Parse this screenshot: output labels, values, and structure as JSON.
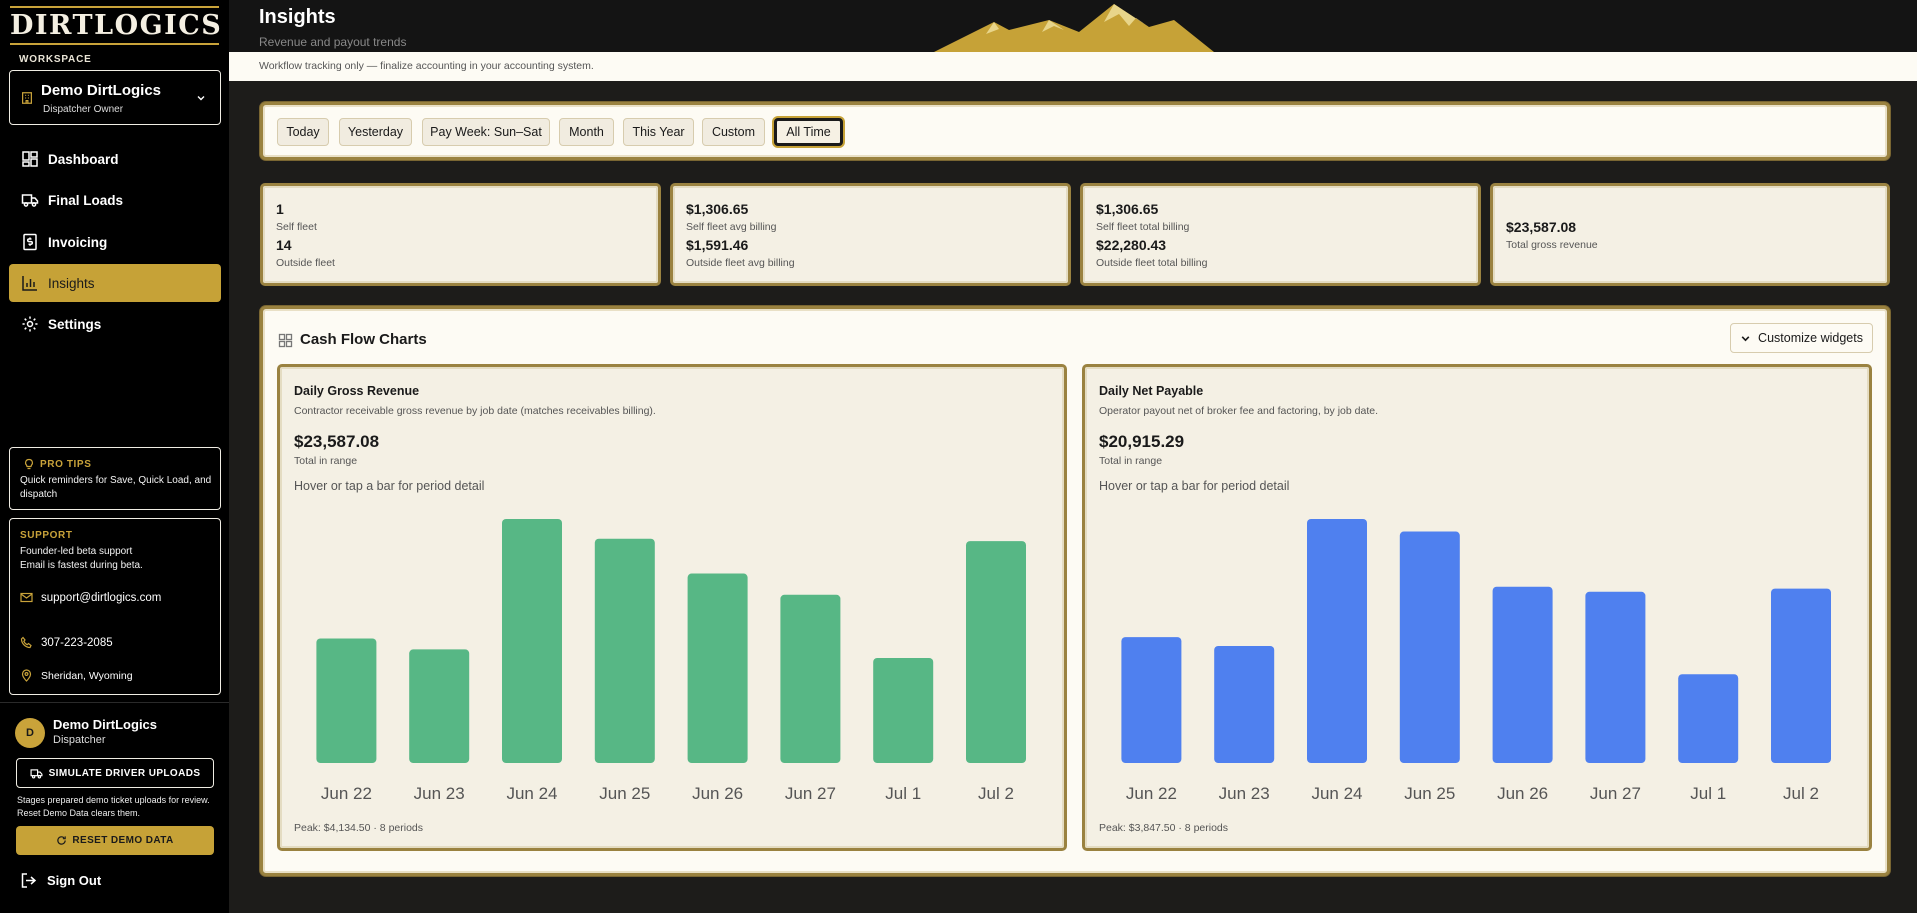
{
  "brand": {
    "logo_text": "DIRTLOGICS"
  },
  "sidebar": {
    "workspace_label": "WORKSPACE",
    "workspace_name": "Demo DirtLogics",
    "workspace_role": "Dispatcher Owner",
    "nav": [
      {
        "label": "Dashboard",
        "icon": "dashboard-icon"
      },
      {
        "label": "Final Loads",
        "icon": "truck-icon"
      },
      {
        "label": "Invoicing",
        "icon": "invoice-icon"
      },
      {
        "label": "Insights",
        "icon": "bar-chart-icon",
        "active": true
      },
      {
        "label": "Settings",
        "icon": "gear-icon"
      }
    ],
    "pro_tips": {
      "title": "PRO TIPS",
      "text": "Quick reminders for Save, Quick Load, and dispatch"
    },
    "support": {
      "title": "SUPPORT",
      "line1": "Founder-led beta support",
      "line2": "Email is fastest during beta.",
      "email": "support@dirtlogics.com",
      "phone": "307-223-2085",
      "location": "Sheridan, Wyoming"
    },
    "user": {
      "initial": "D",
      "name": "Demo DirtLogics",
      "role": "Dispatcher"
    },
    "simulate_label": "SIMULATE DRIVER UPLOADS",
    "simulate_note": "Stages prepared demo ticket uploads for review. Reset Demo Data clears them.",
    "reset_label": "RESET DEMO DATA",
    "sign_out": "Sign Out"
  },
  "header": {
    "title": "Insights",
    "subtitle": "Revenue and payout trends",
    "notice": "Workflow tracking only — finalize accounting in your accounting system."
  },
  "filters": {
    "items": [
      "Today",
      "Yesterday",
      "Pay Week: Sun–Sat",
      "Month",
      "This Year",
      "Custom",
      "All Time"
    ],
    "active": "All Time"
  },
  "stats": {
    "self_fleet": "1",
    "self_fleet_label": "Self fleet",
    "outside_fleet": "14",
    "outside_fleet_label": "Outside fleet",
    "self_avg": "$1,306.65",
    "self_avg_label": "Self fleet avg billing",
    "outside_avg": "$1,591.46",
    "outside_avg_label": "Outside fleet avg billing",
    "self_total": "$1,306.65",
    "self_total_label": "Self fleet total billing",
    "outside_total": "$22,280.43",
    "outside_total_label": "Outside fleet total billing",
    "gross": "$23,587.08",
    "gross_label": "Total gross revenue"
  },
  "cash_flow": {
    "title": "Cash Flow Charts",
    "customize_label": "Customize widgets"
  },
  "colors": {
    "gold": "#c6a237",
    "green": "#57b785",
    "blue": "#4f80ef"
  },
  "chart_data": [
    {
      "type": "bar",
      "title": "Daily Gross Revenue",
      "description": "Contractor receivable gross revenue by job date (matches receivables billing).",
      "total": "$23,587.08",
      "total_label": "Total in range",
      "hint": "Hover or tap a bar for period detail",
      "categories": [
        "Jun 22",
        "Jun 23",
        "Jun 24",
        "Jun 25",
        "Jun 26",
        "Jun 27",
        "Jul 1",
        "Jul 2"
      ],
      "values": [
        2110,
        1925,
        4134.5,
        3800,
        3210,
        2850,
        1780,
        3760
      ],
      "peak_text": "Peak: $4,134.50 · 8 periods",
      "color": "#57b785"
    },
    {
      "type": "bar",
      "title": "Daily Net Payable",
      "description": "Operator payout net of broker fee and factoring, by job date.",
      "total": "$20,915.29",
      "total_label": "Total in range",
      "hint": "Hover or tap a bar for period detail",
      "categories": [
        "Jun 22",
        "Jun 23",
        "Jun 24",
        "Jun 25",
        "Jun 26",
        "Jun 27",
        "Jul 1",
        "Jul 2"
      ],
      "values": [
        1985,
        1845,
        3847.5,
        3650,
        2780,
        2700,
        1400,
        2750
      ],
      "peak_text": "Peak: $3,847.50 · 8 periods",
      "color": "#4f80ef"
    }
  ]
}
